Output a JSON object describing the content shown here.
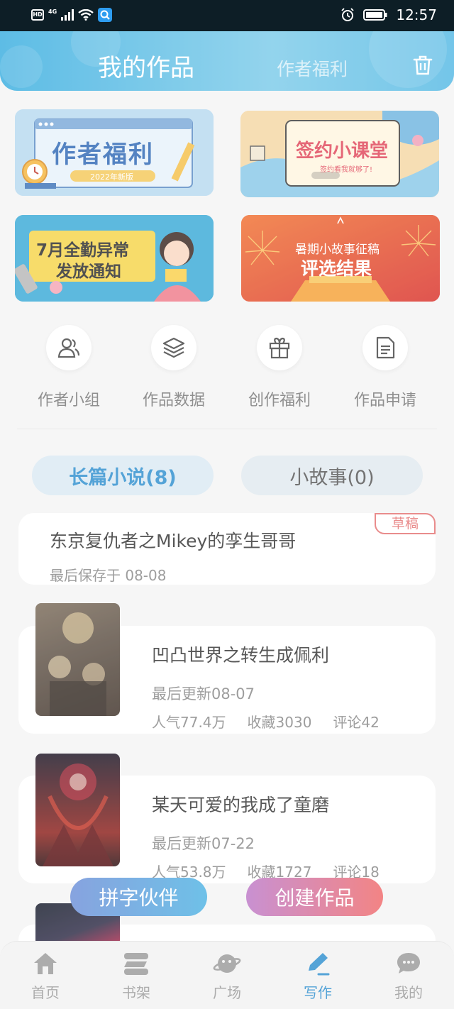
{
  "status_bar": {
    "network_badge": "HD",
    "network_type": "4G",
    "time": "12:57"
  },
  "header": {
    "tab_active": "我的作品",
    "tab_inactive": "作者福利"
  },
  "banners": [
    {
      "title": "作者福利",
      "subtitle": "2022年新版"
    },
    {
      "title": "签约小课堂",
      "subtitle": "签约看我就够了!"
    },
    {
      "title_line1": "7月全勤异常",
      "title_line2": "发放通知"
    },
    {
      "title_line1": "暑期小故事征稿",
      "title_line2": "评选结果"
    }
  ],
  "quick_actions": [
    {
      "label": "作者小组",
      "icon": "group-icon"
    },
    {
      "label": "作品数据",
      "icon": "layers-icon"
    },
    {
      "label": "创作福利",
      "icon": "gift-icon"
    },
    {
      "label": "作品申请",
      "icon": "document-icon"
    }
  ],
  "segments": {
    "long_novel": "长篇小说(8)",
    "short_story": "小故事(0)"
  },
  "works": {
    "draft": {
      "title": "东京复仇者之Mikey的孪生哥哥",
      "saved": "最后保存于 08-08",
      "tag": "草稿"
    },
    "items": [
      {
        "title": "凹凸世界之转生成佩利",
        "updated": "最后更新08-07",
        "popularity": "人气77.4万",
        "favorites": "收藏3030",
        "comments": "评论42"
      },
      {
        "title": "某天可爱的我成了童磨",
        "updated": "最后更新07-22",
        "popularity": "人气53.8万",
        "favorites": "收藏1727",
        "comments": "评论18"
      }
    ]
  },
  "floating_buttons": {
    "partner": "拼字伙伴",
    "create": "创建作品"
  },
  "bottom_nav": [
    {
      "label": "首页",
      "icon": "home-icon"
    },
    {
      "label": "书架",
      "icon": "bookshelf-icon"
    },
    {
      "label": "广场",
      "icon": "planet-icon"
    },
    {
      "label": "写作",
      "icon": "pen-icon"
    },
    {
      "label": "我的",
      "icon": "chat-icon"
    }
  ],
  "colors": {
    "accent_blue": "#2f8fcf",
    "header_blue": "#3aaee0",
    "draft_red": "#e57373"
  }
}
